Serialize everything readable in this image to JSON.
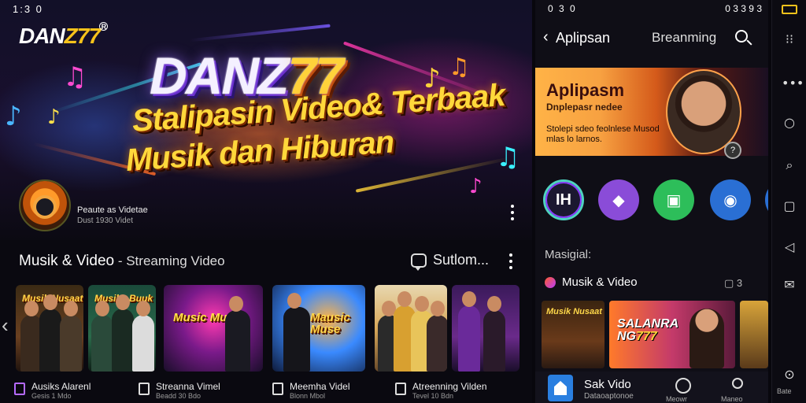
{
  "left": {
    "status_time": "1:3 0",
    "logo": {
      "prefix": "DAN",
      "suffix": "Z77",
      "reg": "R"
    },
    "hero": {
      "brand_prefix": "DANZ",
      "brand_suffix": "77",
      "line1": "Stalipasin Video& Terbaak",
      "line2": "Musik dan Hiburan"
    },
    "channel": {
      "name": "Peaute as Videtae",
      "sub": "Dust 1930 Videt"
    },
    "section": {
      "title": "Musik & Video",
      "sub": " - Streaming Video"
    },
    "subscribe_label": "Sutlom...",
    "cards": [
      {
        "title": "Musik Nusaat"
      },
      {
        "title": "Musike Buuk"
      },
      {
        "title": "Music Musik"
      },
      {
        "title": "Mausic Muse"
      },
      {
        "title": ""
      },
      {
        "title": ""
      }
    ],
    "videos": [
      {
        "title": "Ausiks Alarenl",
        "sub": "Gesis 1 Mdo"
      },
      {
        "title": "Streanna Vimel",
        "sub": "Beadd 30 Bdo"
      },
      {
        "title": "Meemha Videl",
        "sub": "Blonn Mbol"
      },
      {
        "title": "Atreenning Vilden",
        "sub": "Tevel 10 Bdn"
      }
    ]
  },
  "mid": {
    "status_left": "0 3 0",
    "status_right": "0 3 3 9 3",
    "back_symbol": "‹",
    "title": "Aplipsan",
    "tab": "Breanming",
    "promo": {
      "title": "Aplipasm",
      "sub": "Dnplepasr nedee",
      "desc": "Stolepi sdeo feolnlese Musod mlas lo larnos.",
      "badge": "?"
    },
    "app_circles": [
      "IH",
      "◆",
      "▣",
      "◉",
      ""
    ],
    "label": "Masigial:",
    "section_title": "Musik & Video",
    "section_count": "▢ 3",
    "featured": {
      "line1": "SALANRA",
      "line2": "NG",
      "line2_z": "777"
    },
    "nav": {
      "title": "Sak Vido",
      "sub": "Dataoaptonoe",
      "music_label": "Meowr",
      "profile_label": "Maneo"
    }
  },
  "rail": {
    "icons": [
      "⁝⁝",
      "•••",
      "○",
      "⌕",
      "▢",
      "◁",
      "✉",
      "⊙"
    ],
    "label": "Bate"
  },
  "colors": {
    "accent_yellow": "#f6c21b",
    "promo_orange": "#f7a141",
    "app_green": "#2dbe5a",
    "app_purple": "#8a4cd8",
    "app_blue": "#2a6fd4"
  }
}
